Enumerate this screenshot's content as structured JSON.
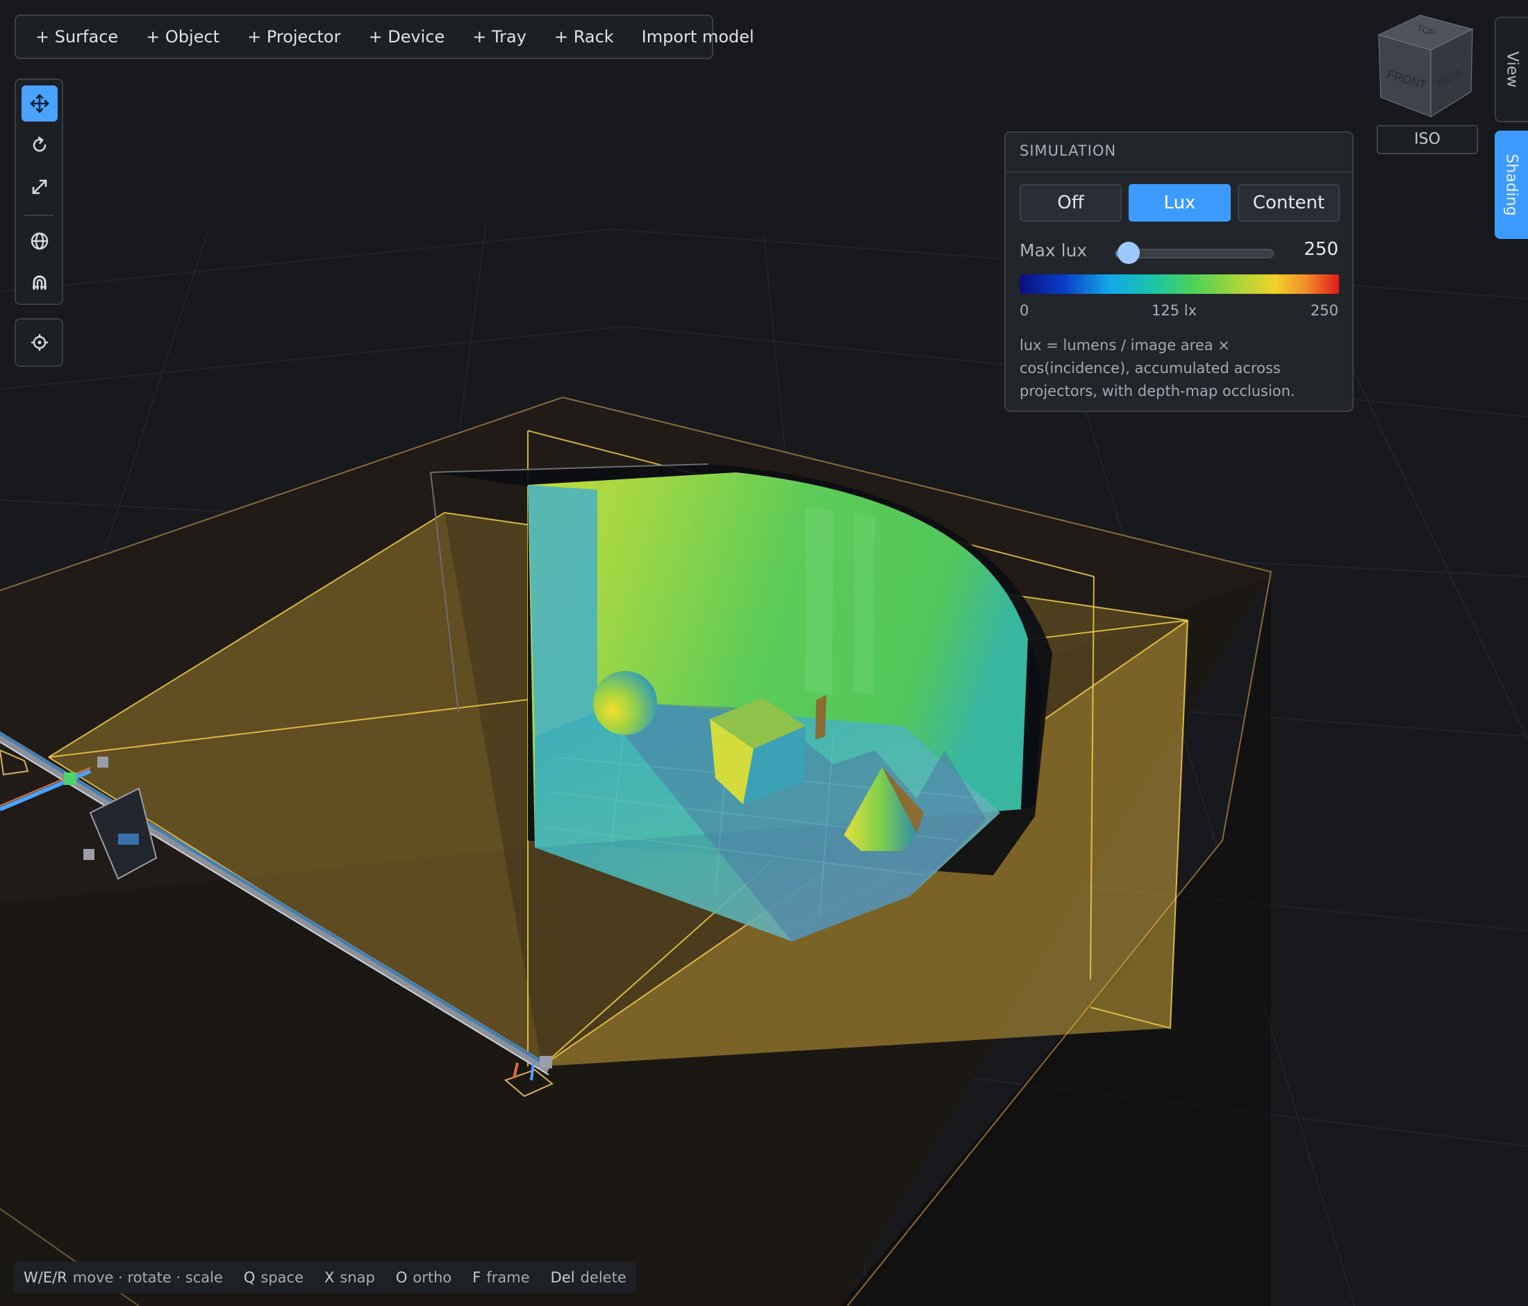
{
  "toolbar": {
    "add_surface": "+ Surface",
    "add_object": "+ Object",
    "add_projector": "+ Projector",
    "add_device": "+ Device",
    "add_tray": "+ Tray",
    "add_rack": "+ Rack",
    "import_model": "Import model"
  },
  "tools": {
    "active": "move",
    "items": [
      "move-icon",
      "rotate-icon",
      "scale-icon",
      "global-space-icon",
      "snap-magnet-icon",
      "focus-target-icon"
    ]
  },
  "viewcube": {
    "top": "TOP",
    "front": "FRONT",
    "right": "RIGHT",
    "iso_label": "ISO"
  },
  "side_tabs": {
    "view": "View",
    "shading": "Shading",
    "active": "Shading"
  },
  "simulation": {
    "title": "SIMULATION",
    "modes": [
      "Off",
      "Lux",
      "Content"
    ],
    "active_mode": "Lux",
    "max_lux_label": "Max lux",
    "max_lux_value": "250",
    "slider_fraction": 0.08,
    "scale_min": "0",
    "scale_mid": "125 lx",
    "scale_max": "250",
    "formula": "lux = lumens / image area × cos(incidence), accumulated across projectors, with depth-map occlusion."
  },
  "shortcuts": [
    {
      "key": "W/E/R",
      "desc": "move · rotate · scale"
    },
    {
      "key": "Q",
      "desc": "space"
    },
    {
      "key": "X",
      "desc": "snap"
    },
    {
      "key": "O",
      "desc": "ortho"
    },
    {
      "key": "F",
      "desc": "frame"
    },
    {
      "key": "Del",
      "desc": "delete"
    }
  ],
  "colors": {
    "accent": "#3d9bff",
    "background": "#17191d",
    "frustum": "#f0c040"
  }
}
